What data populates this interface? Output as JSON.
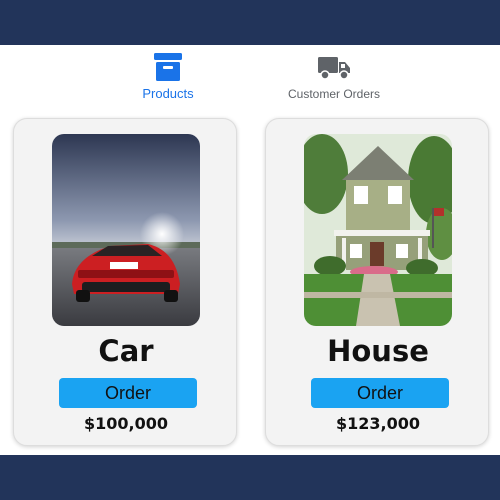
{
  "nav": {
    "tabs": [
      {
        "label": "Products",
        "icon": "archive-box-icon",
        "active": true,
        "color": "#1a73e8"
      },
      {
        "label": "Customer Orders",
        "icon": "truck-icon",
        "active": false,
        "color": "#5f6368"
      }
    ]
  },
  "products": [
    {
      "name": "Car",
      "order_label": "Order",
      "price": "$100,000",
      "image": "red-sports-car-photo"
    },
    {
      "name": "House",
      "order_label": "Order",
      "price": "$123,000",
      "image": "house-painting"
    }
  ],
  "colors": {
    "header_bar": "#22345a",
    "accent_blue": "#1a73e8",
    "order_button": "#1aa3f2",
    "card_background": "#f3f3f3"
  }
}
